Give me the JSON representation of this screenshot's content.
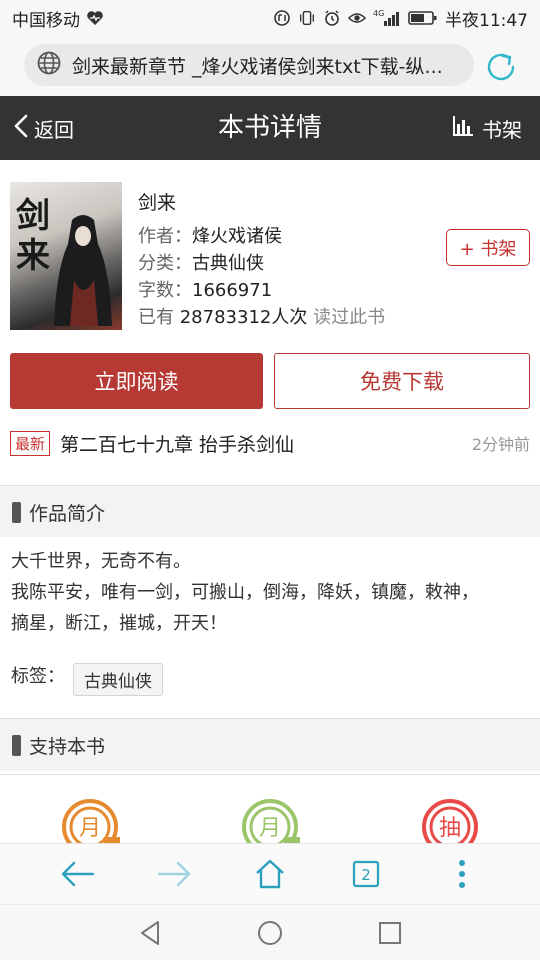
{
  "status_bar": {
    "carrier": "中国移动",
    "network": "4G",
    "time": "半夜11:47"
  },
  "address_bar": {
    "url_text": "剑来最新章节 _烽火戏诸侯剑来txt下载-纵..."
  },
  "header": {
    "back_label": "返回",
    "title": "本书详情",
    "shelf_label": "书架"
  },
  "book": {
    "cover_title": "剑来",
    "title": "剑来",
    "author_label": "作者：",
    "author": "烽火戏诸侯",
    "category_label": "分类：",
    "category": "古典仙侠",
    "words_label": "字数：",
    "words": "1666971",
    "readers_prefix": "已有",
    "readers": "28783312人次",
    "readers_suffix": "读过此书",
    "add_shelf_label": "+ 书架",
    "read_label": "立即阅读",
    "download_label": "免费下载",
    "latest_badge": "最新",
    "latest_chapter": "第二百七十九章 抬手杀剑仙",
    "latest_time": "2分钟前"
  },
  "intro": {
    "heading": "作品简介",
    "lines": [
      "大千世界，无奇不有。",
      "我陈平安，唯有一剑，可搬山，倒海，降妖，镇魔，敕神，",
      "摘星，断江，摧城，开天！"
    ],
    "tags_label": "标签：",
    "tags": [
      "古典仙侠"
    ]
  },
  "support": {
    "heading": "支持本书",
    "items": [
      {
        "char": "月",
        "color": "#e58a2e"
      },
      {
        "char": "月",
        "color": "#9cc56a"
      },
      {
        "char": "抽",
        "color": "#e84a48"
      }
    ]
  },
  "toolbar": {
    "tab_count": "2",
    "accent": "#2e9fbd"
  },
  "colors": {
    "primary_red": "#b73934",
    "header_bg": "#333333"
  }
}
